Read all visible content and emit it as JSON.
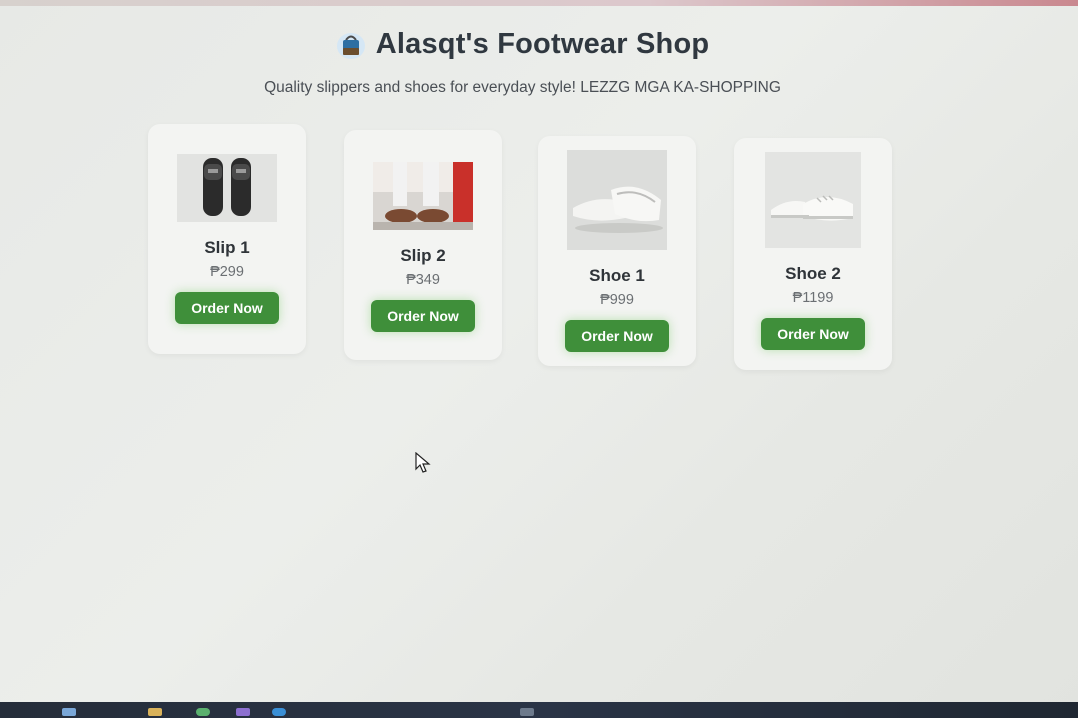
{
  "header": {
    "title": "Alasqt's Footwear Shop",
    "subtitle": "Quality slippers and shoes for everyday style! LEZZG MGA KA-SHOPPING",
    "icon": "shopping-bag-icon"
  },
  "products": [
    {
      "name": "Slip 1",
      "price": "₱299",
      "button": "Order Now",
      "image": "black-slides-image"
    },
    {
      "name": "Slip 2",
      "price": "₱349",
      "button": "Order Now",
      "image": "brown-slides-image"
    },
    {
      "name": "Shoe 1",
      "price": "₱999",
      "button": "Order Now",
      "image": "white-clogs-image"
    },
    {
      "name": "Shoe 2",
      "price": "₱1199",
      "button": "Order Now",
      "image": "white-sneakers-image"
    }
  ],
  "colors": {
    "button": "#3f8f3a",
    "card": "#f3f4f2",
    "background": "#e9ebe8",
    "title": "#303840"
  }
}
